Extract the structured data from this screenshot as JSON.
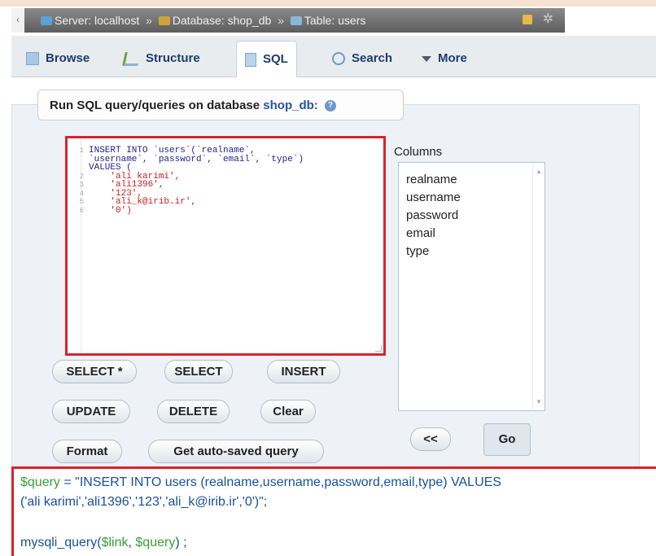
{
  "breadcrumb": {
    "lead_arrow": "‹",
    "server": "Server: localhost",
    "database": "Database: shop_db",
    "table": "Table: users",
    "separator": "»"
  },
  "tabs": [
    {
      "label": "Browse",
      "icon": "browse-icon"
    },
    {
      "label": "Structure",
      "icon": "structure-icon"
    },
    {
      "label": "SQL",
      "icon": "sql-icon"
    },
    {
      "label": "Search",
      "icon": "search-icon"
    },
    {
      "label": "More",
      "icon": "triangle-down-icon"
    }
  ],
  "query_panel": {
    "legend_prefix": "Run SQL query/queries on database",
    "database_link": "shop_db:",
    "help_icon": "?"
  },
  "editor": {
    "lines": [
      {
        "num": "1",
        "text": "INSERT INTO `users`(`realname`,"
      },
      {
        "num": "",
        "text": "`username`, `password`, `email`, `type`)"
      },
      {
        "num": "",
        "text": "VALUES ("
      },
      {
        "num": "2",
        "text": "'ali karimi',"
      },
      {
        "num": "3",
        "text": "'ali1396',"
      },
      {
        "num": "4",
        "text": "'123',"
      },
      {
        "num": "5",
        "text": "'ali_k@irib.ir',"
      },
      {
        "num": "6",
        "text": "'0')"
      }
    ]
  },
  "columns": {
    "label": "Columns",
    "items": [
      "realname",
      "username",
      "password",
      "email",
      "type"
    ]
  },
  "buttons": {
    "select_all": "SELECT *",
    "select": "SELECT",
    "insert": "INSERT",
    "update": "UPDATE",
    "delete": "DELETE",
    "clear": "Clear",
    "format": "Format",
    "auto_saved": "Get auto-saved query",
    "insert_column": "<<",
    "go": "Go"
  },
  "php": {
    "var_query": "$query",
    "line1_rest": " = \"INSERT INTO users (realname,username,password,email,type) VALUES",
    "line2": "('ali karimi','ali1396','123','ali_k@irib.ir','0')\";",
    "fn": "mysqli_query(",
    "var_link": "$link",
    "comma": ", ",
    "var_query2": "$query",
    "close": ") ;"
  }
}
